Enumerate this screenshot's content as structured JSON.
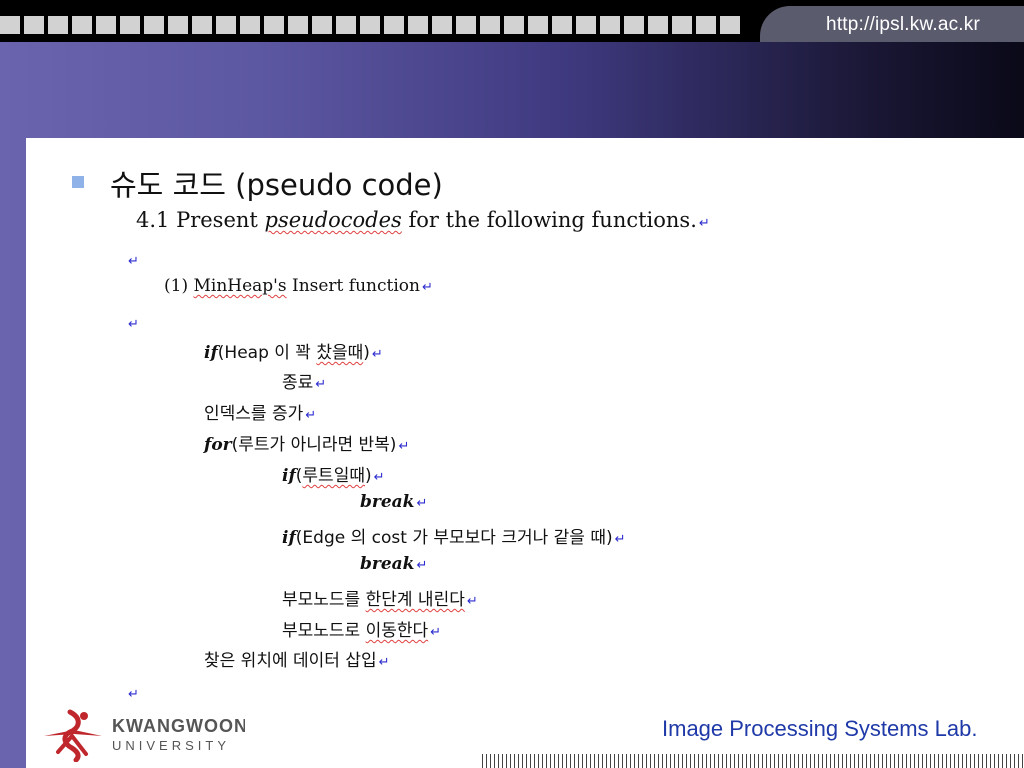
{
  "header": {
    "url": "http://ipsl.kw.ac.kr"
  },
  "slide": {
    "heading": "슈도 코드 (pseudo code)",
    "subtitle": {
      "pre": "4.1 Present ",
      "word": "pseudocodes",
      "post": " for the following functions."
    },
    "return_mark": "↵",
    "item_title": {
      "pre": "(1) ",
      "word": "MinHeap's",
      "post": " Insert function"
    },
    "code": {
      "l1": {
        "kw": "if",
        "pre": "(Heap 이 꽉 ",
        "sq": "찼을때",
        "post": ")"
      },
      "l2": {
        "text": "종료"
      },
      "l3": {
        "text": "인덱스를 증가"
      },
      "l4": {
        "kw": "for",
        "text": "(루트가 아니라면 반복)"
      },
      "l5": {
        "kw": "if",
        "pre": "(",
        "sq": "루트일때",
        "post": ")"
      },
      "l6": {
        "kw": "break"
      },
      "l7": {
        "kw": "if",
        "text": "(Edge 의 cost 가 부모보다 크거나 같을 때)"
      },
      "l8": {
        "kw": "break"
      },
      "l9": {
        "pre": "부모노드를 ",
        "sq": "한단계 내린다",
        "post": ""
      },
      "l10": {
        "pre": "부모노드로 ",
        "sq": "이동한다",
        "post": ""
      },
      "l11": {
        "text": "찾은 위치에 데이터 삽입"
      }
    }
  },
  "footer": {
    "logo": {
      "line1": "KWANGWOON",
      "line2": "UNIVERSITY"
    },
    "lab": "Image Processing Systems Lab."
  }
}
